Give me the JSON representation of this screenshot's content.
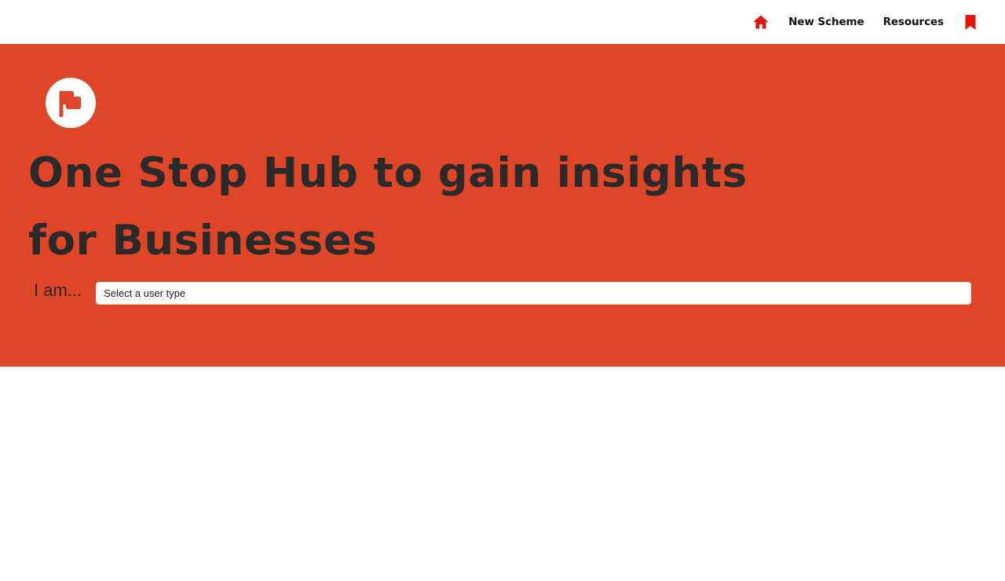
{
  "nav": {
    "home_icon": "home-icon",
    "links": [
      {
        "label": "New Scheme"
      },
      {
        "label": "Resources"
      }
    ],
    "bookmark_icon": "bookmark-icon",
    "icon_color": "#e5120e"
  },
  "hero": {
    "background": "#df4527",
    "logo_icon": "flag-icon",
    "title_line1": "One Stop Hub to gain insights",
    "title_line2": "for Businesses",
    "user_label": "I am...",
    "user_select": {
      "placeholder": "Select a user type"
    }
  }
}
